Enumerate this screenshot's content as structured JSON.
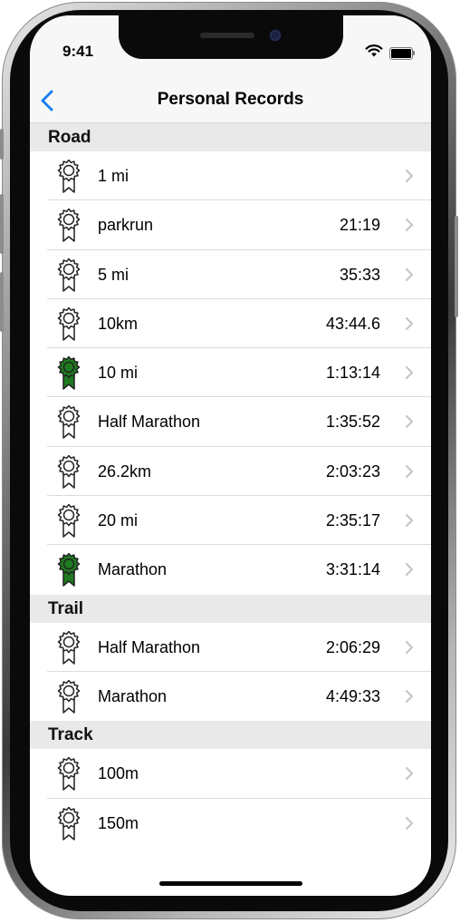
{
  "status_bar": {
    "time": "9:41"
  },
  "nav": {
    "title": "Personal Records"
  },
  "colors": {
    "accent": "#1a7ff0",
    "medal_highlight": "#1f7a1f",
    "medal_outline": "#222222"
  },
  "sections": [
    {
      "title": "Road",
      "rows": [
        {
          "name": "1 mi",
          "time": "",
          "highlight": false
        },
        {
          "name": "parkrun",
          "time": "21:19",
          "highlight": false
        },
        {
          "name": "5 mi",
          "time": "35:33",
          "highlight": false
        },
        {
          "name": "10km",
          "time": "43:44.6",
          "highlight": false
        },
        {
          "name": "10 mi",
          "time": "1:13:14",
          "highlight": true
        },
        {
          "name": "Half Marathon",
          "time": "1:35:52",
          "highlight": false
        },
        {
          "name": "26.2km",
          "time": "2:03:23",
          "highlight": false
        },
        {
          "name": "20 mi",
          "time": "2:35:17",
          "highlight": false
        },
        {
          "name": "Marathon",
          "time": "3:31:14",
          "highlight": true
        }
      ]
    },
    {
      "title": "Trail",
      "rows": [
        {
          "name": "Half Marathon",
          "time": "2:06:29",
          "highlight": false
        },
        {
          "name": "Marathon",
          "time": "4:49:33",
          "highlight": false
        }
      ]
    },
    {
      "title": "Track",
      "rows": [
        {
          "name": "100m",
          "time": "",
          "highlight": false
        },
        {
          "name": "150m",
          "time": "",
          "highlight": false
        }
      ]
    }
  ]
}
